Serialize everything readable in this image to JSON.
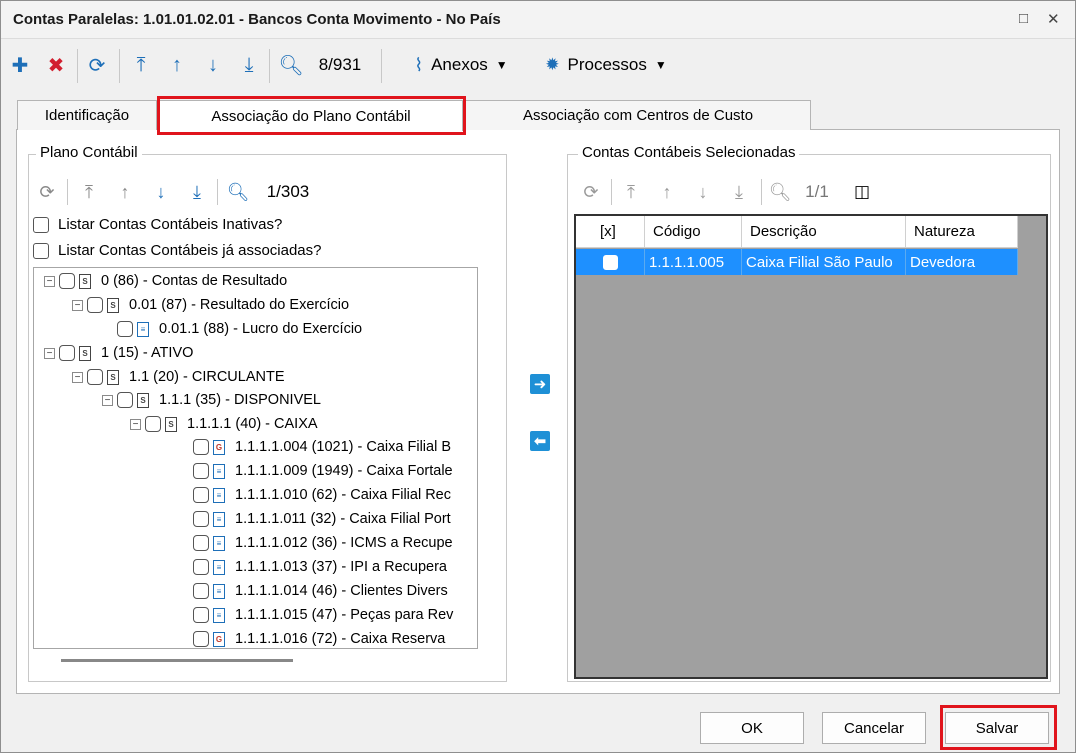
{
  "window": {
    "title": "Contas Paralelas: 1.01.01.02.01 - Bancos Conta Movimento - No País",
    "maximize_icon": "□",
    "close_icon": "✕"
  },
  "toolbar": {
    "record_counter": "8/931",
    "attachments_label": "Anexos",
    "processes_label": "Processos"
  },
  "tabs": [
    "Identificação",
    "Associação do Plano Contábil",
    "Associação com Centros de Custo"
  ],
  "left_group": {
    "title": "Plano Contábil",
    "counter": "1/303",
    "options": [
      "Listar Contas Contábeis Inativas?",
      "Listar Contas Contábeis  já associadas?"
    ],
    "tree": [
      {
        "expander": "−",
        "icon": "S",
        "label": "0 (86) - Contas de Resultado"
      },
      {
        "expander": "−",
        "icon": "S",
        "label": "0.01 (87) - Resultado do Exercício"
      },
      {
        "expander": "",
        "icon": "≡",
        "label": "0.01.1 (88) - Lucro do Exercício"
      },
      {
        "expander": "−",
        "icon": "S",
        "label": "1 (15) - ATIVO"
      },
      {
        "expander": "−",
        "icon": "S",
        "label": "1.1 (20) - CIRCULANTE"
      },
      {
        "expander": "−",
        "icon": "S",
        "label": "1.1.1 (35) - DISPONIVEL"
      },
      {
        "expander": "−",
        "icon": "S",
        "label": "1.1.1.1 (40) - CAIXA"
      },
      {
        "expander": "",
        "icon": "G",
        "label": "1.1.1.1.004 (1021) - Caixa Filial B"
      },
      {
        "expander": "",
        "icon": "≡",
        "label": "1.1.1.1.009 (1949) - Caixa Fortale"
      },
      {
        "expander": "",
        "icon": "≡",
        "label": "1.1.1.1.010 (62) - Caixa Filial Rec"
      },
      {
        "expander": "",
        "icon": "≡",
        "label": "1.1.1.1.011 (32) - Caixa Filial Port"
      },
      {
        "expander": "",
        "icon": "≡",
        "label": "1.1.1.1.012 (36) - ICMS a Recupe"
      },
      {
        "expander": "",
        "icon": "≡",
        "label": "1.1.1.1.013 (37) - IPI a Recupera"
      },
      {
        "expander": "",
        "icon": "≡",
        "label": "1.1.1.1.014 (46) - Clientes Divers"
      },
      {
        "expander": "",
        "icon": "≡",
        "label": "1.1.1.1.015 (47) - Peças para Rev"
      },
      {
        "expander": "",
        "icon": "G",
        "label": "1.1.1.1.016 (72) - Caixa Reserva"
      }
    ]
  },
  "right_group": {
    "title": "Contas Contábeis Selecionadas",
    "counter": "1/1",
    "columns": [
      "[x]",
      "Código",
      "Descrição",
      "Natureza"
    ],
    "rows": [
      {
        "code": "1.1.1.1.005",
        "description": "Caixa Filial São Paulo",
        "nature": "Devedora"
      }
    ]
  },
  "buttons": {
    "ok": "OK",
    "cancel": "Cancelar",
    "save": "Salvar"
  },
  "colors": {
    "highlight_border": "#e0141c",
    "selection": "#1e90ff",
    "accent": "#1e6fb8"
  }
}
